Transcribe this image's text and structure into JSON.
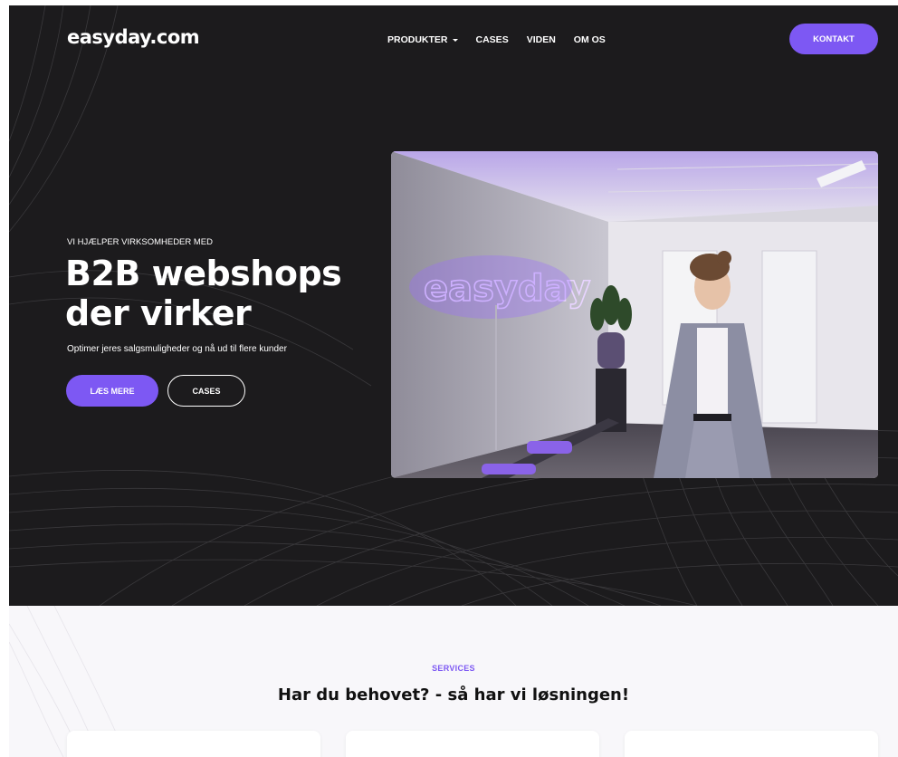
{
  "colors": {
    "accent": "#7d58f3",
    "hero_bg": "#1c1b1d",
    "services_bg": "#f8f7fa"
  },
  "header": {
    "logo": "easyday.com",
    "nav": [
      {
        "label": "PRODUKTER",
        "has_dropdown": true
      },
      {
        "label": "CASES",
        "has_dropdown": false
      },
      {
        "label": "VIDEN",
        "has_dropdown": false
      },
      {
        "label": "OM OS",
        "has_dropdown": false
      }
    ],
    "cta_label": "KONTAKT"
  },
  "hero": {
    "eyebrow": "VI HJÆLPER VIRKSOMHEDER MED",
    "headline": "B2B webshops der virker",
    "subtext": "Optimer jeres salgsmuligheder og nå ud til flere kunder",
    "primary_button": "LÆS MERE",
    "secondary_button": "CASES",
    "image": {
      "neon_sign": "easyday"
    }
  },
  "services": {
    "tag": "SERVICES",
    "title": "Har du behovet? - så har vi løsningen!",
    "cards_count": 3
  }
}
